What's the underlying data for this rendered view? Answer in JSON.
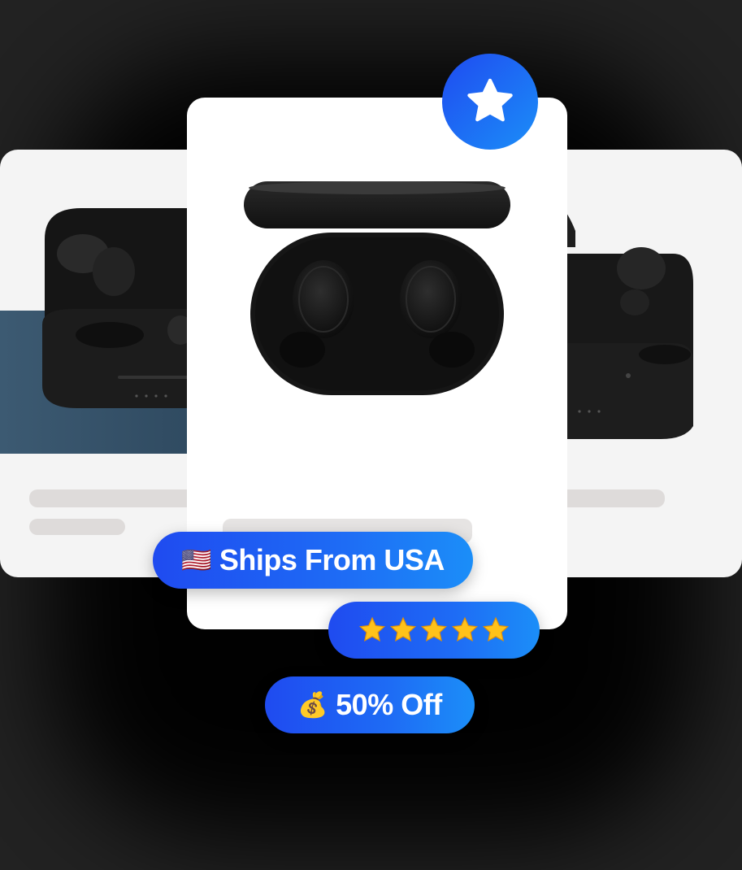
{
  "badges": {
    "ships": {
      "flag": "🇺🇸",
      "label": "Ships From USA"
    },
    "rating": {
      "stars": "★★★★★",
      "count": 5
    },
    "discount": {
      "emoji": "💰",
      "label": "50% Off"
    }
  },
  "favorite_icon": "star-icon",
  "colors": {
    "accent_start": "#1f4bf0",
    "accent_end": "#1b8ef8",
    "star_gold": "#ffc21a",
    "background": "#222222"
  }
}
